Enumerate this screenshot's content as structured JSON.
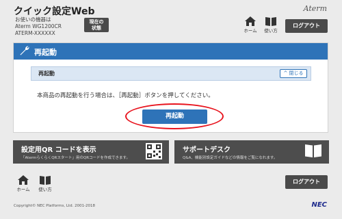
{
  "header": {
    "app_title": "クイック設定Web",
    "device_lines": [
      "お使いの機器は",
      "Aterm WG1200CR",
      "ATERM-XXXXXX"
    ],
    "status_button": [
      "現在の",
      "状態"
    ],
    "brand": "Aterm",
    "home_label": "ホーム",
    "usage_label": "使い方",
    "logout_label": "ログアウト"
  },
  "panel": {
    "title": "再起動",
    "section_title": "再起動",
    "close_label": "閉じる",
    "description": "本商品の再起動を行う場合は、［再起動］ボタンを押してください。",
    "reboot_button": "再起動"
  },
  "cards": {
    "qr": {
      "title": "設定用QR コードを表示",
      "desc": "「AtermらくらくQRスタート」用のQRコードを作成できます。"
    },
    "support": {
      "title": "サポートデスク",
      "desc": "Q&A、機能別設定ガイドなどの情報をご覧になれます。"
    }
  },
  "footer": {
    "home_label": "ホーム",
    "usage_label": "使い方",
    "logout_label": "ログアウト",
    "copyright": "Copyright© NEC Platforms, Ltd. 2001-2018",
    "nec": "NEC"
  },
  "colors": {
    "accent": "#2e73b8",
    "dark_button": "#4a4a4a",
    "highlight": "#e8131d"
  }
}
